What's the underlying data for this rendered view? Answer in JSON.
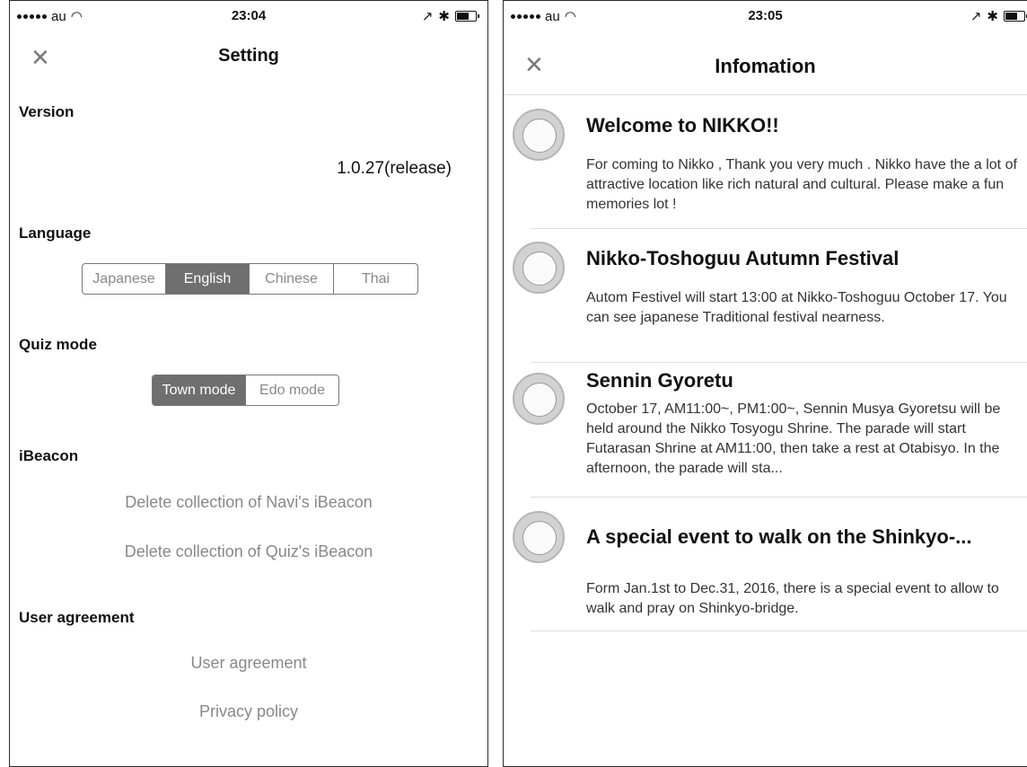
{
  "left": {
    "status": {
      "carrier": "au",
      "time": "23:04"
    },
    "nav": {
      "close": "×",
      "title": "Setting"
    },
    "version": {
      "header": "Version",
      "value": "1.0.27(release)"
    },
    "language": {
      "header": "Language",
      "options": [
        "Japanese",
        "English",
        "Chinese",
        "Thai"
      ],
      "selected": "English"
    },
    "quiz": {
      "header": "Quiz mode",
      "options": [
        "Town mode",
        "Edo mode"
      ],
      "selected": "Town mode"
    },
    "ibeacon": {
      "header": "iBeacon",
      "delete_navi": "Delete collection of Navi's iBeacon",
      "delete_quiz": "Delete collection of Quiz's iBeacon"
    },
    "agreement": {
      "header": "User agreement",
      "user_agreement": "User agreement",
      "privacy": "Privacy policy"
    }
  },
  "right": {
    "status": {
      "carrier": "au",
      "time": "23:05"
    },
    "nav": {
      "close": "×",
      "title": "Infomation"
    },
    "items": [
      {
        "title": "Welcome to NIKKO!!",
        "body": "For coming to Nikko , Thank you very much . Nikko have the a lot of attractive location like rich natural and cultural. Please make a fun memories lot !"
      },
      {
        "title": "Nikko-Toshoguu Autumn Festival",
        "body": "Autom Festivel will start 13:00 at Nikko-Toshoguu October 17. You can see japanese Traditional festival nearness."
      },
      {
        "title": "Sennin Gyoretu",
        "body": "October 17, AM11:00~, PM1:00~, Sennin Musya Gyoretsu will be held around the Nikko Tosyogu Shrine. The parade will start Futarasan Shrine at AM11:00, then take a rest at Otabisyo.  In the afternoon, the parade will sta..."
      },
      {
        "title": "A special event to walk on the Shinkyo-...",
        "body": "Form Jan.1st to Dec.31, 2016, there is a special event to allow to walk and pray on Shinkyo-bridge."
      }
    ]
  },
  "colors": {
    "selected_segment": "#6f6f6f",
    "muted_text": "#888888",
    "divider": "#dddddd"
  }
}
